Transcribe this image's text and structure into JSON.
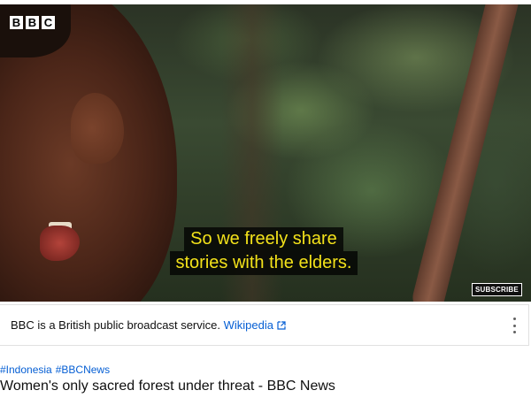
{
  "video": {
    "logo_letters": [
      "B",
      "B",
      "C"
    ],
    "subtitle_lines": [
      "So we freely share",
      "stories with the elders."
    ],
    "subscribe_label": "SUBSCRIBE"
  },
  "info_panel": {
    "text": "BBC is a British public broadcast service. ",
    "link_label": "Wikipedia",
    "link_icon": "external-link-icon",
    "more_icon": "more-vert-icon"
  },
  "hashtags": [
    "#Indonesia",
    "#BBCNews"
  ],
  "title": "Women's only sacred forest under threat - BBC News",
  "colors": {
    "subtitle_text": "#f3e21a",
    "link": "#065fd4"
  }
}
